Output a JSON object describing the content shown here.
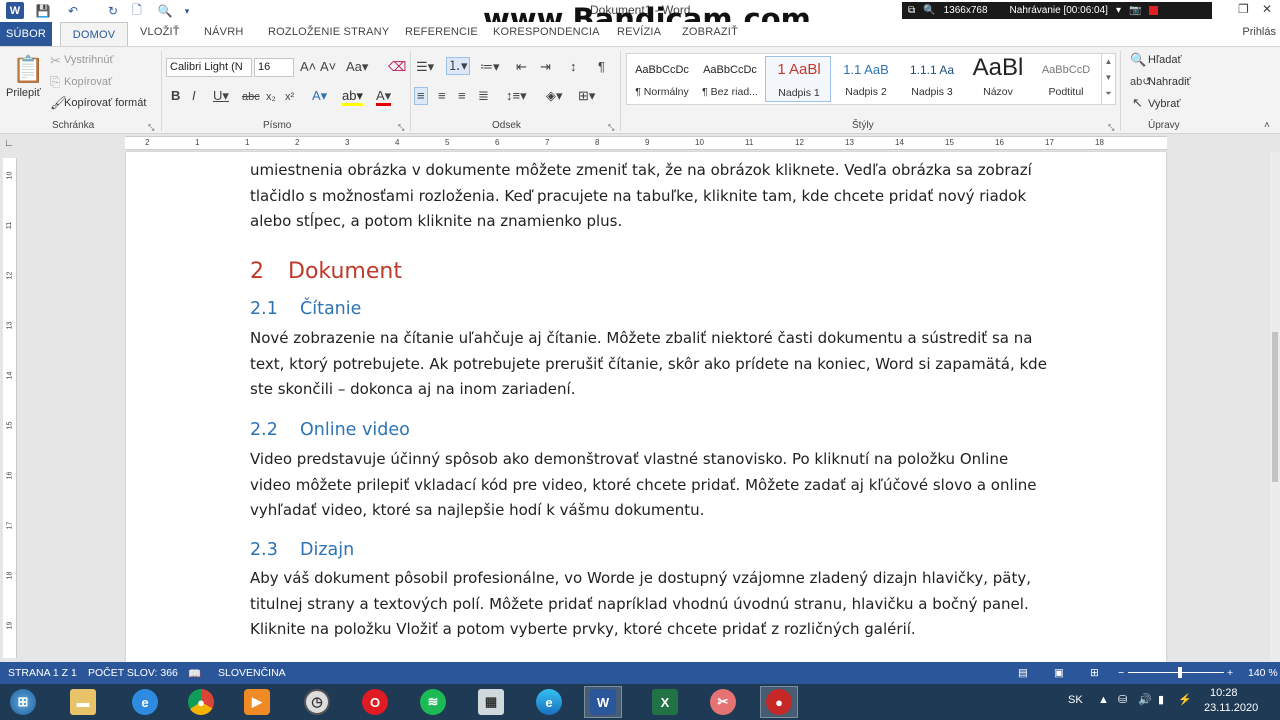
{
  "window": {
    "title": "Dokument1 - Word",
    "watermark": "www.Bandicam.com",
    "recording": {
      "resolution": "1366x768",
      "status": "Nahrávanie [00:06:04]"
    }
  },
  "tabs": {
    "file": "SÚBOR",
    "items": [
      "DOMOV",
      "VLOŽIŤ",
      "NÁVRH",
      "ROZLOŽENIE STRANY",
      "REFERENCIE",
      "KORESPONDENCIA",
      "REVÍZIA",
      "ZOBRAZIŤ"
    ],
    "user": "Prihlás"
  },
  "ribbon": {
    "clipboard": {
      "paste": "Prilepiť",
      "cut": "Vystrihnúť",
      "copy": "Kopírovať",
      "format_painter": "Kopírovať formát",
      "label": "Schránka"
    },
    "font": {
      "name": "Calibri Light (N",
      "size": "16",
      "label": "Písmo"
    },
    "paragraph": {
      "label": "Odsek"
    },
    "styles": {
      "label": "Štýly",
      "items": [
        {
          "preview": "AaBbCcDc",
          "name": "¶ Normálny"
        },
        {
          "preview": "AaBbCcDc",
          "name": "¶ Bez riad..."
        },
        {
          "preview": "1  AaBl",
          "name": "Nadpis 1"
        },
        {
          "preview": "1.1  AaB",
          "name": "Nadpis 2"
        },
        {
          "preview": "1.1.1  Aa",
          "name": "Nadpis 3"
        },
        {
          "preview": "AaBl",
          "name": "Názov"
        },
        {
          "preview": "AaBbCcD",
          "name": "Podtitul"
        }
      ]
    },
    "editing": {
      "find": "Hľadať",
      "replace": "Nahradiť",
      "select": "Vybrať",
      "label": "Úpravy"
    }
  },
  "ruler": {
    "h_ticks": [
      "2",
      "1",
      "1",
      "2",
      "3",
      "4",
      "5",
      "6",
      "7",
      "8",
      "9",
      "10",
      "11",
      "12",
      "13",
      "14",
      "15",
      "16",
      "17",
      "18"
    ],
    "v_ticks": [
      "10",
      "11",
      "12",
      "13",
      "14",
      "15",
      "16",
      "17",
      "18",
      "19"
    ]
  },
  "document": {
    "intro": "umiestnenia obrázka v dokumente môžete zmeniť tak, že na obrázok kliknete. Vedľa obrázka sa zobrazí tlačidlo s možnosťami rozloženia. Keď pracujete na tabuľke, kliknite tam, kde chcete pridať nový riadok alebo stĺpec, a potom kliknite na znamienko plus.",
    "h1": {
      "num": "2",
      "text": "Dokument"
    },
    "sections": [
      {
        "num": "2.1",
        "title": "Čítanie",
        "body": "Nové zobrazenie na čítanie uľahčuje aj čítanie. Môžete zbaliť niektoré časti dokumentu a sústrediť sa na text, ktorý potrebujete. Ak potrebujete prerušiť čítanie, skôr ako prídete na koniec, Word si zapamätá, kde ste skončili – dokonca aj na inom zariadení."
      },
      {
        "num": "2.2",
        "title": "Online video",
        "body": "Video predstavuje účinný spôsob ako demonštrovať vlastné stanovisko. Po kliknutí na položku Online video môžete prilepiť vkladací kód pre video, ktoré chcete pridať. Môžete zadať aj kľúčové slovo a online vyhľadať video, ktoré sa najlepšie hodí k vášmu dokumentu."
      },
      {
        "num": "2.3",
        "title": "Dizajn",
        "body": "Aby váš dokument pôsobil profesionálne, vo Worde je dostupný vzájomne zladený dizajn hlavičky, päty, titulnej strany a textových polí. Môžete pridať napríklad vhodnú úvodnú stranu, hlavičku a bočný panel. Kliknite na položku Vložiť a potom vyberte prvky, ktoré chcete pridať z rozličných galérií."
      }
    ]
  },
  "status": {
    "page": "STRANA 1 Z 1",
    "words": "POČET SLOV: 366",
    "language": "SLOVENČINA",
    "zoom": "140 %"
  },
  "taskbar": {
    "lang": "SK",
    "time": "10:28",
    "date": "23.11.2020"
  }
}
